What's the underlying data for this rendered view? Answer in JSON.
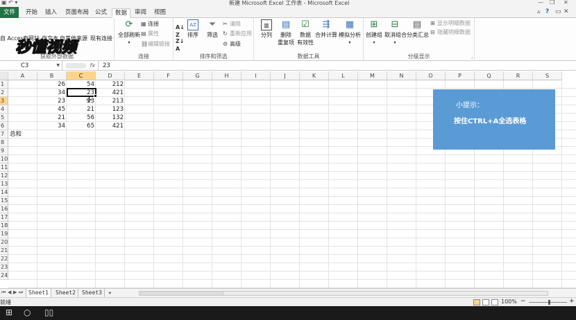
{
  "window": {
    "title": "新建 Microsoft Excel 工作表 - Microsoft Excel"
  },
  "tabs": [
    "文件",
    "开始",
    "插入",
    "页面布局",
    "公式",
    "数据",
    "审阅",
    "视图"
  ],
  "active_tab": "数据",
  "ribbon": {
    "watermark": "秒懂视频",
    "external": {
      "access": "自 Access",
      "web": "自网站",
      "text": "自文本",
      "other": "自其他来源",
      "existing": "现有连接",
      "label": "获取外部数据"
    },
    "connections": {
      "refresh": "全部刷新",
      "connections": "连接",
      "properties": "属性",
      "edit_links": "编辑链接",
      "label": "连接"
    },
    "sort": {
      "sort": "排序",
      "filter": "筛选",
      "clear": "清除",
      "reapply": "重新应用",
      "advanced": "高级",
      "label": "排序和筛选"
    },
    "tools": {
      "split": "分列",
      "remove_dup": "删除\n重复项",
      "validation": "数据\n有效性",
      "consolidate": "合并计算",
      "whatif": "模拟分析",
      "label": "数据工具"
    },
    "outline": {
      "group": "创建组",
      "ungroup": "取消组合",
      "subtotal": "分类汇总",
      "show": "显示明细数据",
      "hide": "隐藏明细数据",
      "label": "分级显示"
    }
  },
  "formula_bar": {
    "name_box": "C3",
    "fx": "fx",
    "value": "23"
  },
  "columns": [
    "A",
    "B",
    "C",
    "D",
    "E",
    "F",
    "G",
    "H",
    "I",
    "J",
    "K",
    "L",
    "M",
    "N",
    "O",
    "P",
    "Q",
    "R",
    "S"
  ],
  "rows": [
    "1",
    "2",
    "3",
    "4",
    "5",
    "6",
    "7",
    "8",
    "9",
    "10",
    "11",
    "12",
    "13",
    "14",
    "15",
    "16",
    "17",
    "18",
    "19",
    "20",
    "21",
    "22",
    "23",
    "24"
  ],
  "cells": {
    "B": [
      "26",
      "34",
      "23",
      "45",
      "21",
      "34"
    ],
    "C": [
      "54",
      "23",
      "23",
      "21",
      "56",
      "65"
    ],
    "D": [
      "212",
      "421",
      "213",
      "123",
      "132",
      "421"
    ],
    "A7": "总和"
  },
  "tip": {
    "title": "小提示：",
    "body": "按住CTRL+A全选表格"
  },
  "sheets": [
    "Sheet1",
    "Sheet2",
    "Sheet3"
  ],
  "status": {
    "ready": "就绪",
    "zoom": "100%"
  },
  "colors": {
    "accent": "#217346",
    "tip_bg": "#5b9bd5",
    "selection": "#ffd58c"
  }
}
